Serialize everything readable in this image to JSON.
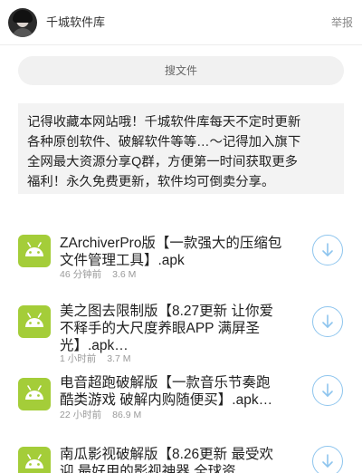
{
  "header": {
    "site_name": "千城软件库",
    "report_label": "举报"
  },
  "search": {
    "label": "搜文件"
  },
  "notice": {
    "line1": "记得收藏本网站哦！千城软件库每天不定时更新",
    "line2": "各种原创软件、破解软件等等…～记得加入旗下",
    "line3": "全网最大资源分享Q群，方便第一时间获取更多",
    "line4": "福利！永久免费更新，软件均可倒卖分享。"
  },
  "files": [
    {
      "icon": "android-icon",
      "title_lines": [
        "ZArchiverPro版【一款强大的压缩包",
        "文件管理工具】.apk"
      ],
      "time": "46 分钟前",
      "size": "3.6 M"
    },
    {
      "icon": "android-icon",
      "title_lines": [
        "美之图去限制版【8.27更新 让你爱",
        "不释手的大尺度养眼APP 满屏圣",
        "光】.apk…"
      ],
      "time": "1 小时前",
      "size": "3.7 M"
    },
    {
      "icon": "android-icon",
      "title_lines": [
        "电音超跑破解版【一款音乐节奏跑",
        "酷类游戏 破解内购随便买】.apk…"
      ],
      "time": "22 小时前",
      "size": "86.9 M"
    },
    {
      "icon": "android-icon",
      "title_lines": [
        "南瓜影视破解版【8.26更新 最受欢",
        "迎 最好用的影视神器 全球资"
      ],
      "time": "",
      "size": ""
    }
  ],
  "colors": {
    "android_green": "#a4cd39",
    "download_blue": "#8ec5ee",
    "notice_bg": "#f3f3f3",
    "search_bg": "#f1f1f1"
  }
}
